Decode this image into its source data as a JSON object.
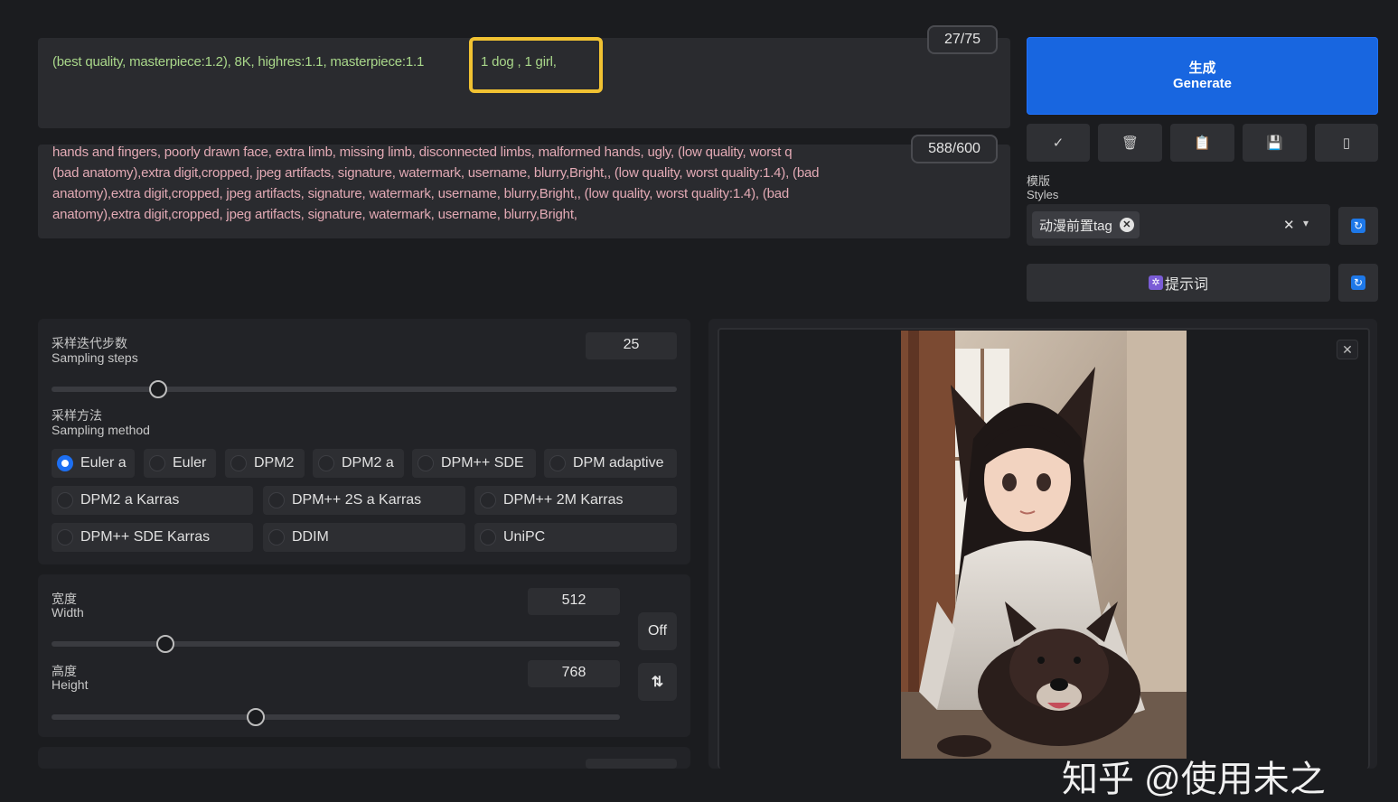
{
  "prompt": {
    "positive_text": "(best quality, masterpiece:1.2), 8K, highres:1.1, masterpiece:1.1",
    "highlighted_text": "1 dog , 1 girl,",
    "token_count": "27/75"
  },
  "negative_prompt": {
    "lines": [
      "hands and fingers, poorly drawn face, extra limb, missing limb, disconnected limbs, malformed hands, ugly, (low quality, worst q",
      "(bad anatomy),extra digit,cropped, jpeg artifacts, signature, watermark, username, blurry,Bright,, (low quality, worst quality:1.4), (bad",
      "anatomy),extra digit,cropped, jpeg artifacts, signature, watermark, username, blurry,Bright,, (low quality, worst quality:1.4), (bad",
      "anatomy),extra digit,cropped, jpeg artifacts, signature, watermark, username, blurry,Bright,"
    ],
    "token_count": "588/600"
  },
  "generate": {
    "label_zh": "生成",
    "label_en": "Generate"
  },
  "tool_buttons": [
    "✓",
    "🗑",
    "📋",
    "💾",
    "▯"
  ],
  "styles": {
    "label_zh": "模版",
    "label_en": "Styles",
    "selected_chip": "动漫前置tag",
    "clear_icon": "✕",
    "dropdown_icon": "▾"
  },
  "prompt_helper_button": "提示词",
  "sampling_steps": {
    "label_zh": "采样迭代步数",
    "label_en": "Sampling steps",
    "value": "25",
    "slider_fraction": 0.17
  },
  "sampling_method": {
    "label_zh": "采样方法",
    "label_en": "Sampling method",
    "selected": "Euler a",
    "row1": [
      "Euler a",
      "Euler",
      "DPM2",
      "DPM2 a",
      "DPM++ SDE",
      "DPM adaptive"
    ],
    "row2": [
      "DPM2 a Karras",
      "DPM++ 2S a Karras",
      "DPM++ 2M Karras"
    ],
    "row3": [
      "DPM++ SDE Karras",
      "DDIM",
      "UniPC"
    ]
  },
  "width": {
    "label_zh": "宽度",
    "label_en": "Width",
    "value": "512",
    "slider_fraction": 0.2
  },
  "height": {
    "label_zh": "高度",
    "label_en": "Height",
    "value": "768",
    "slider_fraction": 0.36
  },
  "off_button": "Off",
  "swap_icon": "⇅",
  "output": {
    "close_icon": "✕",
    "watermark": "知乎 @使用未之"
  }
}
